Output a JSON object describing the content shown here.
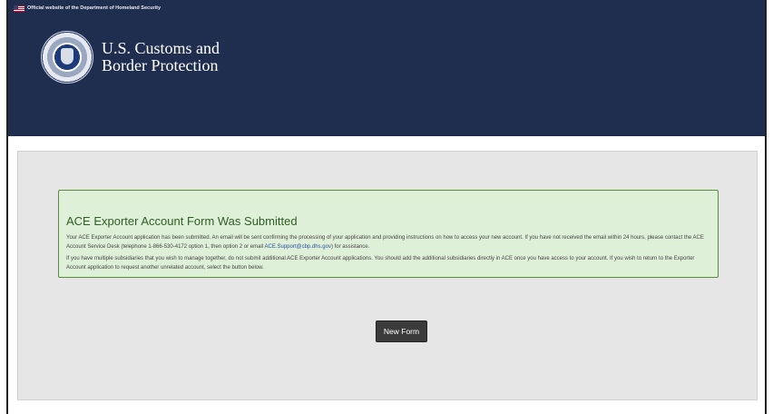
{
  "gov_banner": {
    "text": "Official website of the Department of Homeland Security"
  },
  "brand": {
    "line1": "U.S. Customs and",
    "line2": "Border Protection"
  },
  "alert": {
    "title": "ACE Exporter Account Form Was Submitted",
    "para1_pre": "Your ACE Exporter Account application has been submitted. An email will be sent confirming the processing of your application and providing instructions on how to access your new account. If you have not received the email within 24 hours, please contact the ACE Account Service Desk (telephone 1-866-530-4172 option 1, then option 2 or email ",
    "email": "ACE.Support@cbp.dhs.gov",
    "para1_post": ") for assistance.",
    "para2": "If you have multiple subsidiaries that you wish to manage together, do not submit additional ACE Exporter Account applications. You should add the additional subsidiaries directly in ACE once you have access to your account. If you wish to return to the Exporter Account application to request another unrelated account, select the button below."
  },
  "button": {
    "label": "New Form"
  },
  "colors": {
    "header": "#1f2d4f",
    "alert_bg": "#dff0d8",
    "alert_title": "#2e5e23",
    "button": "#3b3b3b"
  }
}
